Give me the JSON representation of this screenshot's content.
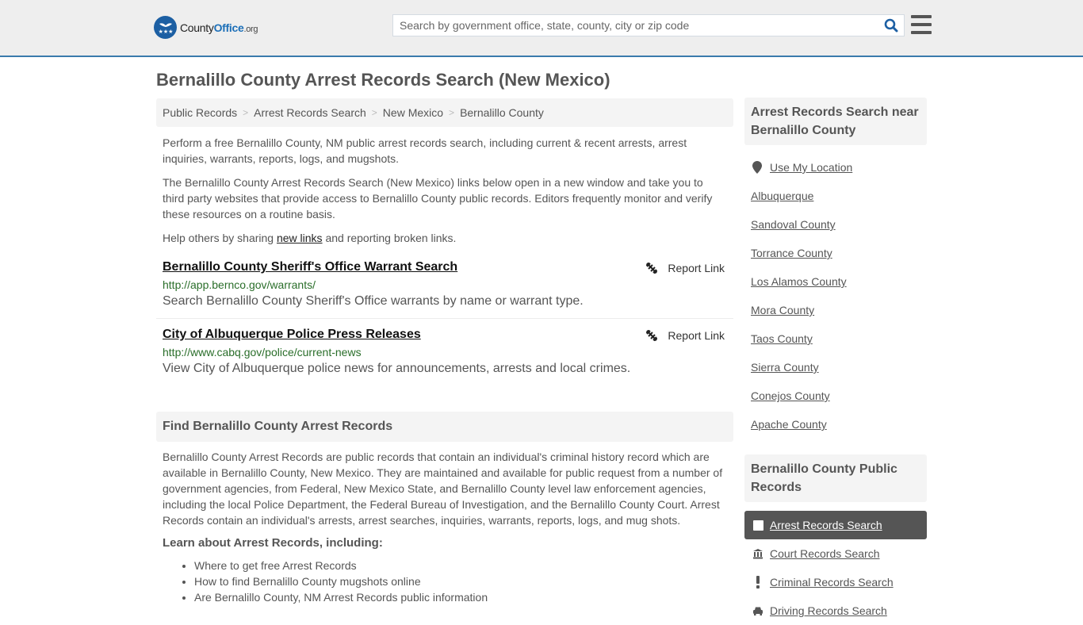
{
  "header": {
    "logo": {
      "county": "County",
      "office": "Office",
      "org": ".org"
    },
    "search": {
      "placeholder": "Search by government office, state, county, city or zip code",
      "value": ""
    },
    "icons": {
      "search": "search-icon",
      "menu": "hamburger-menu-icon",
      "logo": "eagle-stars-logo-icon"
    }
  },
  "page_title": "Bernalillo County Arrest Records Search (New Mexico)",
  "breadcrumb": [
    {
      "label": "Public Records"
    },
    {
      "label": "Arrest Records Search"
    },
    {
      "label": "New Mexico"
    },
    {
      "label": "Bernalillo County"
    }
  ],
  "breadcrumb_separator": ">",
  "intro": {
    "p1": "Perform a free Bernalillo County, NM public arrest records search, including current & recent arrests, arrest inquiries, warrants, reports, logs, and mugshots.",
    "p2": "The Bernalillo County Arrest Records Search (New Mexico) links below open in a new window and take you to third party websites that provide access to Bernalillo County public records. Editors frequently monitor and verify these resources on a routine basis.",
    "p3_before": "Help others by sharing ",
    "p3_link": "new links",
    "p3_after": " and reporting broken links."
  },
  "links": [
    {
      "title": "Bernalillo County Sheriff's Office Warrant Search",
      "url": "http://app.bernco.gov/warrants/",
      "description": "Search Bernalillo County Sheriff's Office warrants by name or warrant type.",
      "report_label": "Report Link"
    },
    {
      "title": "City of Albuquerque Police Press Releases",
      "url": "http://www.cabq.gov/police/current-news",
      "description": "View City of Albuquerque police news for announcements, arrests and local crimes.",
      "report_label": "Report Link"
    }
  ],
  "find_section": {
    "heading": "Find Bernalillo County Arrest Records",
    "body": "Bernalillo County Arrest Records are public records that contain an individual's criminal history record which are available in Bernalillo County, New Mexico. They are maintained and available for public request from a number of government agencies, from Federal, New Mexico State, and Bernalillo County level law enforcement agencies, including the local Police Department, the Federal Bureau of Investigation, and the Bernalillo County Court. Arrest Records contain an individual's arrests, arrest searches, inquiries, warrants, reports, logs, and mug shots.",
    "learn_heading": "Learn about Arrest Records, including:",
    "learn_items": [
      "Where to get free Arrest Records",
      "How to find Bernalillo County mugshots online",
      "Are Bernalillo County, NM Arrest Records public information"
    ]
  },
  "sidebar": {
    "near_heading": "Arrest Records Search near Bernalillo County",
    "use_location": "Use My Location",
    "near_items": [
      "Albuquerque",
      "Sandoval County",
      "Torrance County",
      "Los Alamos County",
      "Mora County",
      "Taos County",
      "Sierra County",
      "Conejos County",
      "Apache County"
    ],
    "public_records_heading": "Bernalillo County Public Records",
    "public_records_items": [
      {
        "label": "Arrest Records Search",
        "icon": "square-icon",
        "active": true
      },
      {
        "label": "Court Records Search",
        "icon": "courthouse-icon",
        "active": false
      },
      {
        "label": "Criminal Records Search",
        "icon": "exclamation-icon",
        "active": false
      },
      {
        "label": "Driving Records Search",
        "icon": "car-icon",
        "active": false
      }
    ]
  },
  "colors": {
    "header_bg": "#eeeeee",
    "header_border": "#3a7bac",
    "logo_blue": "#1c5fa3",
    "url_green": "#2a6e2a",
    "active_item_bg": "#555555"
  }
}
